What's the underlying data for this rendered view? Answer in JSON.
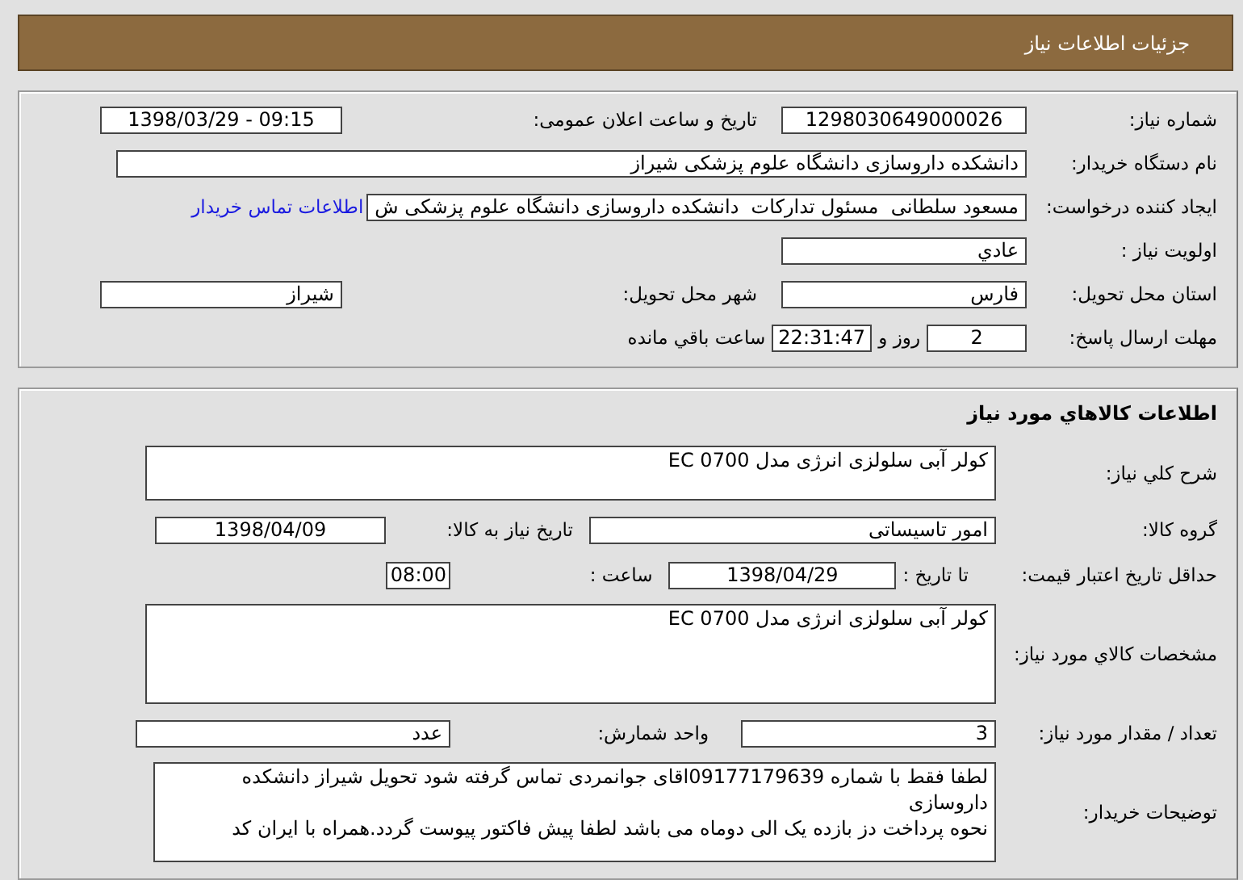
{
  "header": {
    "title": "جزئیات اطلاعات نیاز"
  },
  "need_info": {
    "need_number": {
      "label": "شماره نیاز:",
      "value": "1298030649000026"
    },
    "announce_datetime": {
      "label": "تاریخ و ساعت اعلان عمومی:",
      "value": "1398/03/29 - 09:15"
    },
    "buyer_org": {
      "label": "نام دستگاه خریدار:",
      "value": "دانشکده داروسازی دانشگاه علوم پزشکی شیراز"
    },
    "requester": {
      "label": "ایجاد کننده درخواست:",
      "value": "مسعود سلطانی  مسئول تدارکات  دانشکده داروسازی دانشگاه علوم پزشکی ش",
      "contact_link": "اطلاعات تماس خریدار"
    },
    "priority": {
      "label": "اولویت نیاز :",
      "value": "عادي"
    },
    "delivery_province": {
      "label": "استان محل تحویل:",
      "value": "فارس"
    },
    "delivery_city": {
      "label": "شهر محل تحویل:",
      "value": "شیراز"
    },
    "deadline": {
      "label": "مهلت ارسال پاسخ:",
      "days": "2",
      "days_unit": "روز و",
      "time": "22:31:47",
      "suffix": "ساعت باقي مانده"
    }
  },
  "goods": {
    "title": "اطلاعات کالاهاي مورد نیاز",
    "general_description": {
      "label": "شرح کلي نیاز:",
      "value": "کولر آبی سلولزی انرژی مدل EC 0700"
    },
    "goods_group": {
      "label": "گروه کالا:",
      "value": "امور تاسیساتی"
    },
    "need_date": {
      "label": "تاریخ نیاز به کالا:",
      "value": "1398/04/09"
    },
    "price_validity": {
      "label": "حداقل تاریخ اعتبار قیمت:",
      "date_label": "تا تاریخ :",
      "date": "1398/04/29",
      "time_label": "ساعت :",
      "time": "08:00"
    },
    "specifications": {
      "label": "مشخصات کالاي مورد نیاز:",
      "value": "کولر آبی سلولزی انرژی مدل EC 0700"
    },
    "quantity": {
      "label": "تعداد / مقدار مورد نیاز:",
      "value": "3"
    },
    "unit": {
      "label": "واحد شمارش:",
      "value": "عدد"
    },
    "buyer_notes": {
      "label": "توضیحات خریدار:",
      "value": "لطفا فقط با شماره 09177179639اقای جوانمردی تماس گرفته شود تحویل شیراز دانشکده داروسازی\nنحوه پرداخت دز بازده یک الی دوماه می باشد لطفا پیش فاکتور پیوست گردد.همراه با ایران کد"
    }
  }
}
